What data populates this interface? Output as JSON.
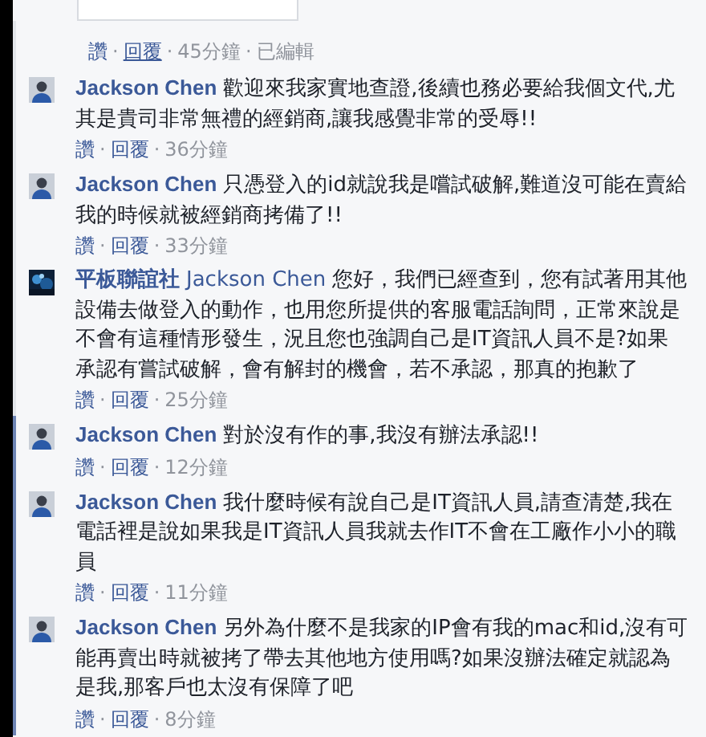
{
  "separator": "·",
  "top_actions": {
    "like": "讚",
    "reply": "回覆",
    "reply_hovered": true,
    "time": "45分鐘",
    "edited": "已編輯"
  },
  "comments": [
    {
      "kind": "person",
      "author": "Jackson Chen",
      "author_page": false,
      "text": "歡迎來我家實地查證,後續也務必要給我個文代,尤其是貴司非常無禮的經銷商,讓我感覺非常的受辱!!",
      "like": "讚",
      "reply": "回覆",
      "time": "36分鐘",
      "unread": false
    },
    {
      "kind": "person",
      "author": "Jackson Chen",
      "author_page": false,
      "text": "只憑登入的id就說我是嚐試破解,難道沒可能在賣給我的時候就被經銷商拷備了!!",
      "like": "讚",
      "reply": "回覆",
      "time": "33分鐘",
      "unread": false
    },
    {
      "kind": "page",
      "author": "平板聯誼社",
      "author_page": true,
      "mention": "Jackson Chen",
      "text": "您好，我們已經查到，您有試著用其他設備去做登入的動作，也用您所提供的客服電話詢問，正常來說是不會有這種情形發生，況且您也強調自己是IT資訊人員不是?如果承認有嘗試破解，會有解封的機會，若不承認，那真的抱歉了",
      "like": "讚",
      "reply": "回覆",
      "time": "25分鐘",
      "unread": false
    },
    {
      "kind": "person",
      "author": "Jackson Chen",
      "author_page": false,
      "text": "對於沒有作的事,我沒有辦法承認!!",
      "like": "讚",
      "reply": "回覆",
      "time": "12分鐘",
      "unread": true
    },
    {
      "kind": "person",
      "author": "Jackson Chen",
      "author_page": false,
      "text": "我什麼時候有說自己是IT資訊人員,請查清楚,我在電話裡是說如果我是IT資訊人員我就去作IT不會在工廠作小小的職員",
      "like": "讚",
      "reply": "回覆",
      "time": "11分鐘",
      "unread": true
    },
    {
      "kind": "person",
      "author": "Jackson Chen",
      "author_page": false,
      "text": "另外為什麼不是我家的IP會有我的mac和id,沒有可能再賣出時就被拷了帶去其他地方使用嗎?如果沒辦法確定就認為是我,那客戶也太沒有保障了吧",
      "like": "讚",
      "reply": "回覆",
      "time": "8分鐘",
      "unread": true
    }
  ]
}
